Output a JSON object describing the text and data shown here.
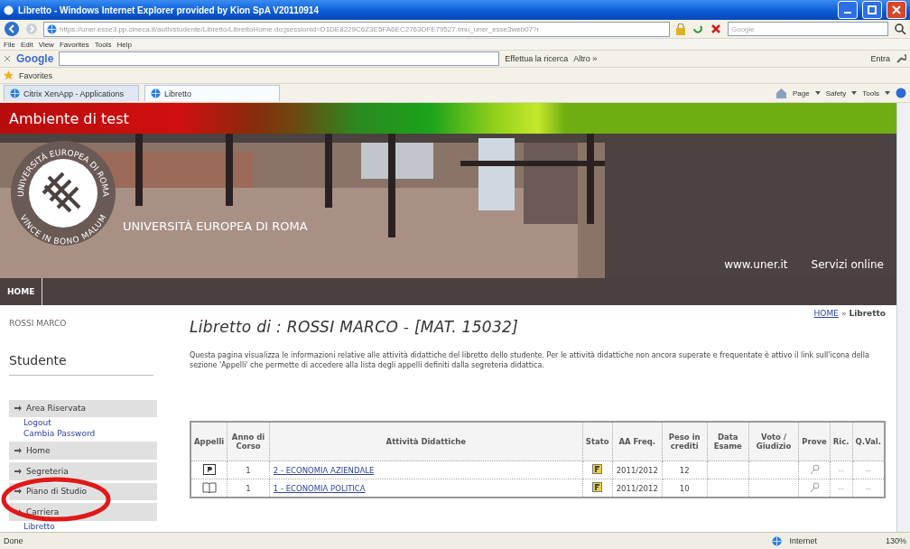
{
  "window": {
    "title": "Libretto - Windows Internet Explorer provided by Kion SpA V20110914"
  },
  "address_bar": {
    "url": "https://uner.esse3.pp.cineca.it/auth/studente/Libretto/LibrettoHome.do;jsessionid=D1DE8229C6Z3E5FA6EC2763DFE79527.tmu_uner_esse3web07?r",
    "search_placeholder": "Google"
  },
  "menu": [
    "File",
    "Edit",
    "View",
    "Favorites",
    "Tools",
    "Help"
  ],
  "google_toolbar": {
    "logo": "Google",
    "search_button": "Effettua la ricerca",
    "more": "Altro »",
    "sign_in": "Entra"
  },
  "favorites_bar": {
    "label": "Favorites"
  },
  "tabs": [
    {
      "label": "Citrix XenApp - Applications",
      "selected": false
    },
    {
      "label": "Libretto",
      "selected": true
    }
  ],
  "command_bar": [
    "Page",
    "Safety",
    "Tools"
  ],
  "page": {
    "env_banner": "Ambiente di test",
    "university": {
      "top_arc": "UNIVERSITÀ EUROPEA DI ROMA",
      "bottom_arc": "VINCE IN BONO MALUM",
      "name": "UNIVERSITÀ EUROPEA DI ROMA"
    },
    "header_links": [
      "www.uner.it",
      "Servizi online"
    ],
    "nav": [
      {
        "label": "HOME",
        "selected": true
      }
    ],
    "breadcrumb": {
      "link": "HOME",
      "separator": "»",
      "current": "Libretto"
    },
    "user": "ROSSI MARCO",
    "sidebar": {
      "title": "Studente",
      "sections": [
        {
          "label": "Area Riservata",
          "children": [
            {
              "label": "Logout"
            },
            {
              "label": "Cambia Password"
            }
          ]
        },
        {
          "label": "Home"
        },
        {
          "label": "Segreteria"
        },
        {
          "label": "Piano di Studio"
        },
        {
          "label": "Carriera",
          "children": [
            {
              "label": "Libretto"
            }
          ]
        }
      ]
    },
    "heading": "Libretto di : ROSSI MARCO - [MAT. 15032]",
    "intro": "Questa pagina visualizza le informazioni relative alle attività didattiche del libretto dello studente. Per le attività didattiche non ancora superate e frequentate è attivo il link sull'icona della sezione 'Appelli' che permette di accedere alla lista degli appelli definiti dalla segreteria didattica.",
    "table": {
      "columns": [
        "Appelli",
        "Anno di Corso",
        "Attività Didattiche",
        "Stato",
        "AA Freq.",
        "Peso in crediti",
        "Data Esame",
        "Voto / Giudizio",
        "Prove",
        "Ric.",
        "Q.Val."
      ],
      "rows": [
        {
          "bookable": true,
          "anno": "1",
          "activity": "2 - ECONOMIA AZIENDALE",
          "aa": "2011/2012",
          "peso": "12",
          "ric": "--",
          "qval": "--"
        },
        {
          "bookable": false,
          "anno": "1",
          "activity": "1 - ECONOMIA POLITICA",
          "aa": "2011/2012",
          "peso": "10",
          "ric": "--",
          "qval": "--"
        }
      ]
    }
  },
  "status_bar": {
    "text": "Done",
    "zone": "Internet",
    "zoom": "130%"
  }
}
